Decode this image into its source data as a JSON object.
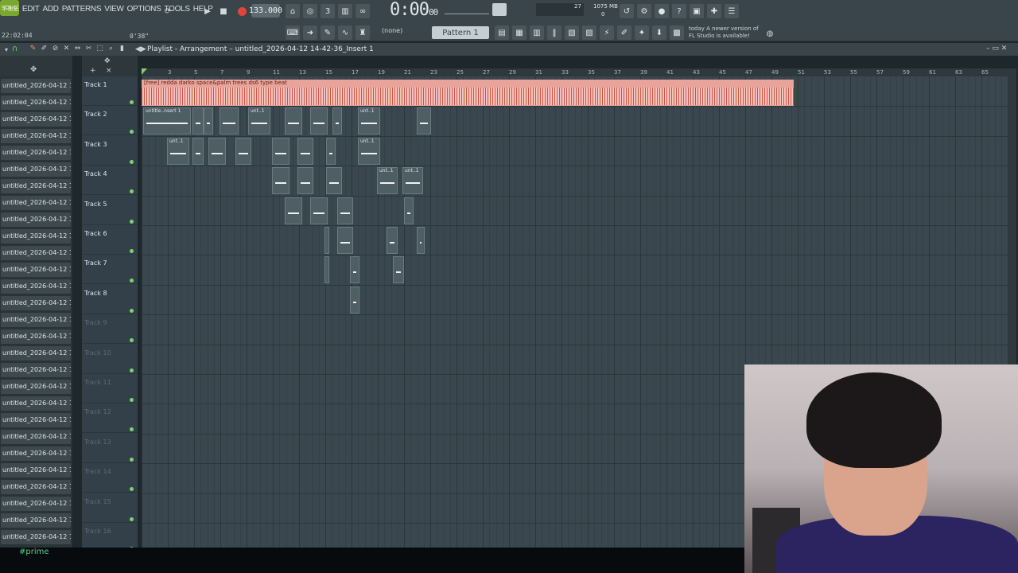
{
  "menu": [
    "FILE",
    "EDIT",
    "ADD",
    "PATTERNS",
    "VIEW",
    "OPTIONS",
    "TOOLS",
    "HELP"
  ],
  "transport": {
    "mode": "SONG",
    "tempo": "133.000",
    "clock_main": "0:00",
    "clock_sub": "00",
    "time_left": "22:02:04",
    "time_right": "0'38\""
  },
  "monitor": {
    "cpu": "27",
    "mem": "1075 MB",
    "poly": "0"
  },
  "update_note": {
    "line1": "today  A newer version of",
    "line2": "FL Studio is available!"
  },
  "pattern_selector": "Pattern 1",
  "snap_selector": "(none)",
  "playlist": {
    "title": "Playlist - Arrangement",
    "project": "untitled_2026-04-12 14-42-36_Insert 1"
  },
  "browser_item": "untitled_2026-04-12 14-...",
  "browser_count": 28,
  "tracks": [
    "Track 1",
    "Track 2",
    "Track 3",
    "Track 4",
    "Track 5",
    "Track 6",
    "Track 7",
    "Track 8",
    "Track 9",
    "Track 10",
    "Track 11",
    "Track 12",
    "Track 13",
    "Track 14",
    "Track 15",
    "Track 16"
  ],
  "ruler": [
    "3",
    "5",
    "7",
    "9",
    "11",
    "13",
    "15",
    "17",
    "19",
    "21",
    "23",
    "25",
    "27",
    "29",
    "31",
    "33",
    "35",
    "37",
    "39",
    "41",
    "43",
    "45",
    "47",
    "49",
    "51",
    "53",
    "55",
    "57",
    "59",
    "61",
    "63",
    "65"
  ],
  "audio_clip_label": "[free] redda darko  space&palm trees  ds6 type beat",
  "pattern_clip_label": "untitle..nsert 1",
  "pattern_clip_short": "unt..1",
  "overlay_tag": "#prime"
}
